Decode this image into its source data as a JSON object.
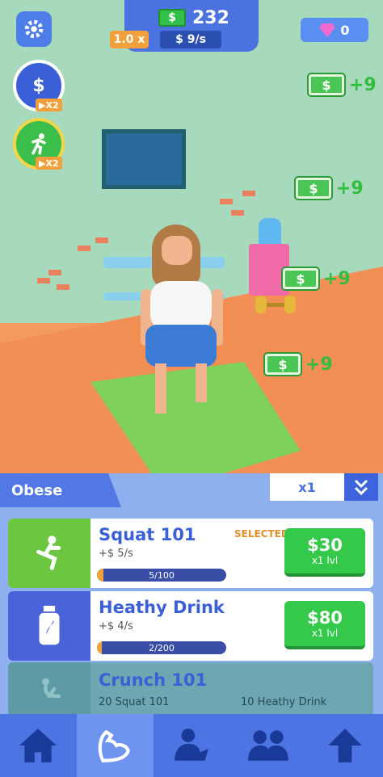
{
  "hud": {
    "cash": "232",
    "multiplier": "1.0 x",
    "rate": "$ 9/s",
    "gems": "0",
    "cash_icon": "$",
    "booster_badge": "X2"
  },
  "floating_income": [
    "+9",
    "+9",
    "+9",
    "+9"
  ],
  "panel": {
    "body_type": "Obese",
    "buy_multiplier": "x1"
  },
  "exercises": [
    {
      "name": "Squat 101",
      "income": "+$ 5/s",
      "progress": "5/100",
      "progress_value": 0.05,
      "price": "$30",
      "level_step": "x1 lvl",
      "status": "SELECTED"
    },
    {
      "name": "Heathy Drink",
      "income": "+$ 4/s",
      "progress": "2/200",
      "progress_value": 0.01,
      "price": "$80",
      "level_step": "x1 lvl",
      "status": ""
    }
  ],
  "locked": {
    "name": "Crunch 101",
    "req1": "20 Squat 101",
    "req2": "10 Heathy Drink"
  },
  "nav": [
    "home-icon",
    "muscle-icon",
    "workout-icon",
    "team-icon",
    "upgrade-arrow-icon"
  ],
  "colors": {
    "accent": "#4c74e3",
    "buy": "#34c94a",
    "cash": "#2fbe3f",
    "badge": "#f2a03c"
  }
}
